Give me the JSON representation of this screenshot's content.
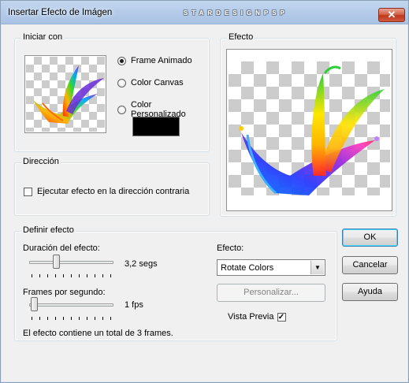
{
  "window": {
    "title": "Insertar Efecto de Imágen",
    "watermark": "STARDESIGNPSP",
    "close_label": "✕"
  },
  "start_group": {
    "label": "Iniciar con",
    "options": [
      {
        "label": "Frame Animado",
        "selected": true
      },
      {
        "label": "Color Canvas",
        "selected": false
      },
      {
        "label": "Color Personalizado",
        "selected": false
      }
    ],
    "custom_color": "#000000"
  },
  "effect_preview": {
    "label": "Efecto"
  },
  "direction_group": {
    "label": "Dirección",
    "reverse_label": "Ejecutar efecto en la dirección contraria",
    "reverse_checked": false
  },
  "define_group": {
    "label": "Definir efecto",
    "duration_label": "Duración del efecto:",
    "duration_value": "3,2 segs",
    "duration_position": 0.3,
    "fps_label": "Frames por segundo:",
    "fps_value": "1 fps",
    "fps_position": 0.0,
    "effect_label": "Efecto:",
    "effect_selected": "Rotate Colors",
    "customize_label": "Personalizar...",
    "preview_label": "Vista Previa",
    "preview_checked": true,
    "summary": "El efecto contiene un total de 3 frames."
  },
  "buttons": {
    "ok": "OK",
    "cancel": "Cancelar",
    "help": "Ayuda"
  },
  "colors": {
    "title_bar": "#b7cde9",
    "dialog_bg": "#f0f0f0",
    "close_red": "#c9462b",
    "default_focus": "#3c7fb1"
  }
}
